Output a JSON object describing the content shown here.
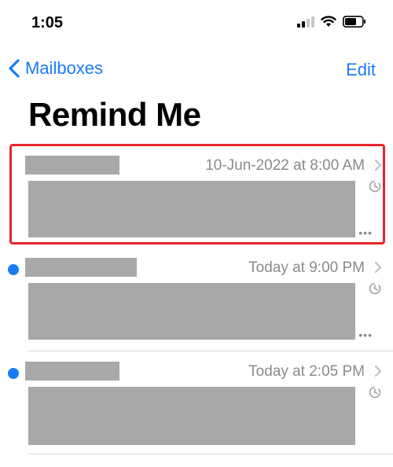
{
  "status_bar": {
    "time": "1:05"
  },
  "nav": {
    "back_label": "Mailboxes",
    "edit_label": "Edit"
  },
  "title": "Remind Me",
  "mails": [
    {
      "date": "10-Jun-2022 at 8:00 AM",
      "unread": false
    },
    {
      "date": "Today at 9:00 PM",
      "unread": true
    },
    {
      "date": "Today at 2:05 PM",
      "unread": true
    }
  ],
  "colors": {
    "accent": "#1a7cf5",
    "highlight": "#e8262b",
    "unread_dot": "#1a7cf5"
  },
  "icons": [
    "chevron-left-icon",
    "chevron-right-icon",
    "clock-icon",
    "more-icon",
    "signal-icon",
    "wifi-icon",
    "battery-icon"
  ]
}
